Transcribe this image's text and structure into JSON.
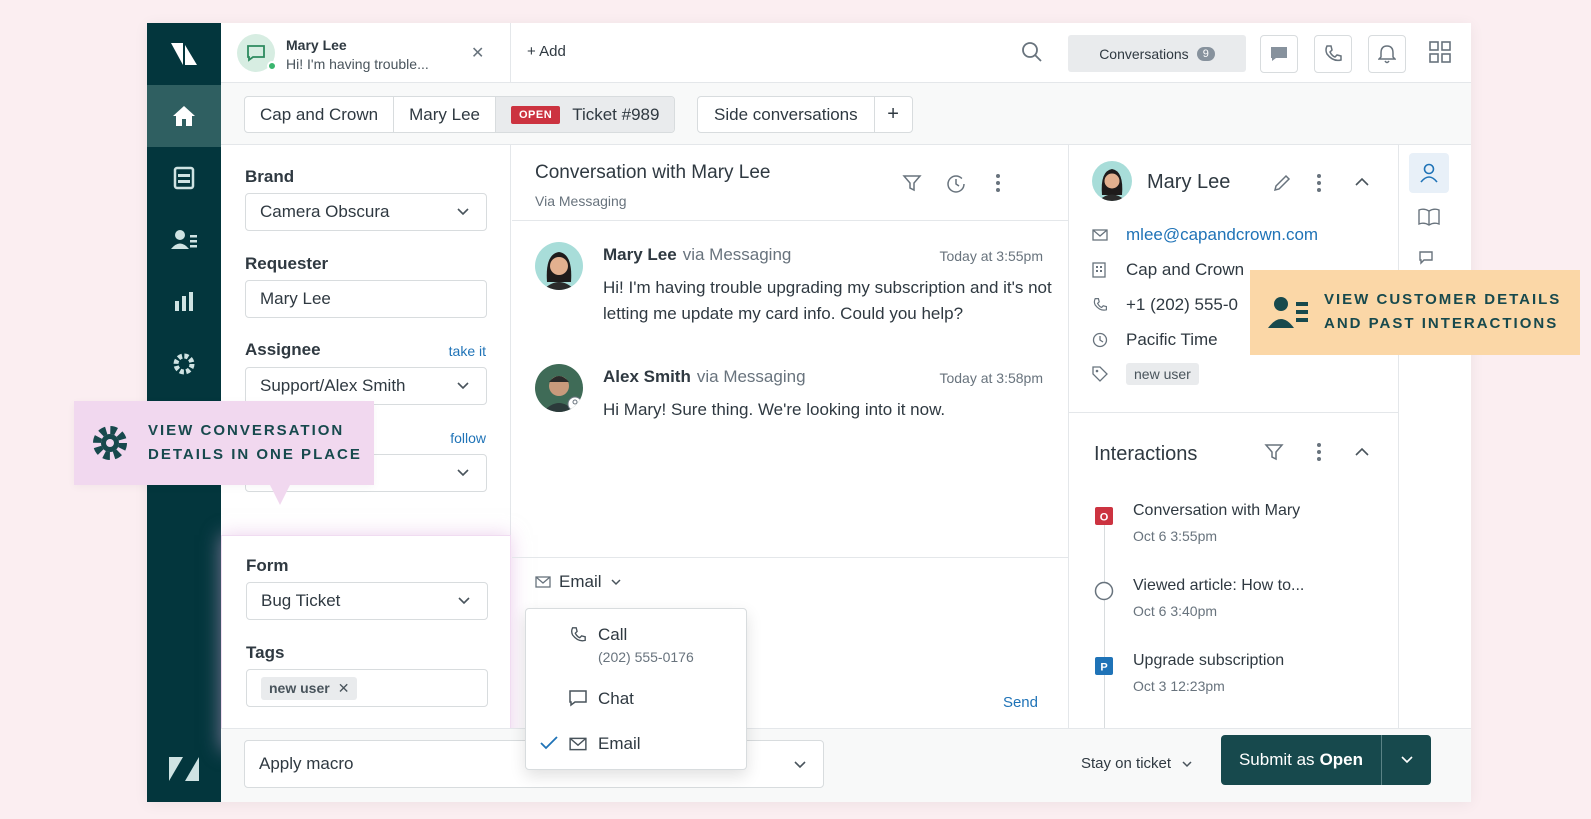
{
  "topbar": {
    "conv_tab": {
      "name": "Mary Lee",
      "preview": "Hi! I'm having trouble..."
    },
    "add_label": "+ Add",
    "conversations_label": "Conversations",
    "conversations_count": "9"
  },
  "tabs": {
    "crumbs": [
      "Cap and Crown",
      "Mary Lee"
    ],
    "ticket_status": "OPEN",
    "ticket_label": "Ticket #989",
    "side_conversations": "Side conversations",
    "plus": "+"
  },
  "fields": {
    "brand_label": "Brand",
    "brand_value": "Camera Obscura",
    "requester_label": "Requester",
    "requester_value": "Mary Lee",
    "assignee_label": "Assignee",
    "assignee_link": "take it",
    "assignee_value": "Support/Alex Smith",
    "follow_link": "follow",
    "form_label": "Form",
    "form_value": "Bug Ticket",
    "tags_label": "Tags",
    "tag_value": "new user"
  },
  "conversation": {
    "title": "Conversation with Mary Lee",
    "subtitle": "Via Messaging",
    "messages": [
      {
        "name": "Mary Lee",
        "via": "via Messaging",
        "time": "Today at 3:55pm",
        "text": "Hi! I'm having trouble upgrading my subscription and it's not letting me update my card info. Could you help?"
      },
      {
        "name": "Alex Smith",
        "via": "via Messaging",
        "time": "Today at 3:58pm",
        "text": "Hi Mary! Sure thing. We're looking into it now."
      }
    ],
    "channel": "Email",
    "send": "Send"
  },
  "channel_dropdown": {
    "items": [
      {
        "label": "Call",
        "sub": "(202) 555-0176",
        "icon": "phone-icon"
      },
      {
        "label": "Chat",
        "sub": "",
        "icon": "chat-icon"
      },
      {
        "label": "Email",
        "sub": "",
        "icon": "mail-icon",
        "selected": true
      }
    ]
  },
  "customer": {
    "name": "Mary Lee",
    "email": "mlee@capandcrown.com",
    "organization": "Cap and Crown",
    "phone": "+1 (202) 555-0",
    "timezone": "Pacific Time",
    "tag": "new user"
  },
  "interactions": {
    "title": "Interactions",
    "items": [
      {
        "title": "Conversation with Mary",
        "date": "Oct 6 3:55pm",
        "badge": "O",
        "color": "#cc3340"
      },
      {
        "title": "Viewed article: How to...",
        "date": "Oct 6 3:40pm",
        "badge": "",
        "color": "#ffffff"
      },
      {
        "title": "Upgrade subscription",
        "date": "Oct 3 12:23pm",
        "badge": "P",
        "color": "#1f73b7"
      }
    ]
  },
  "bottombar": {
    "macro": "Apply macro",
    "stay": "Stay on ticket",
    "submit_prefix": "Submit as",
    "submit_status": "Open"
  },
  "callouts": {
    "left_line1": "VIEW CONVERSATION",
    "left_line2": "DETAILS IN ONE PLACE",
    "right_line1": "VIEW CUSTOMER DETAILS",
    "right_line2": "AND PAST INTERACTIONS"
  },
  "colors": {
    "rail": "#03363d",
    "accent_blue": "#1f73b7",
    "open_red": "#cc3340",
    "submit": "#17494d",
    "callout_pink": "#f1d8ef",
    "callout_orange": "#fbd7a7"
  }
}
